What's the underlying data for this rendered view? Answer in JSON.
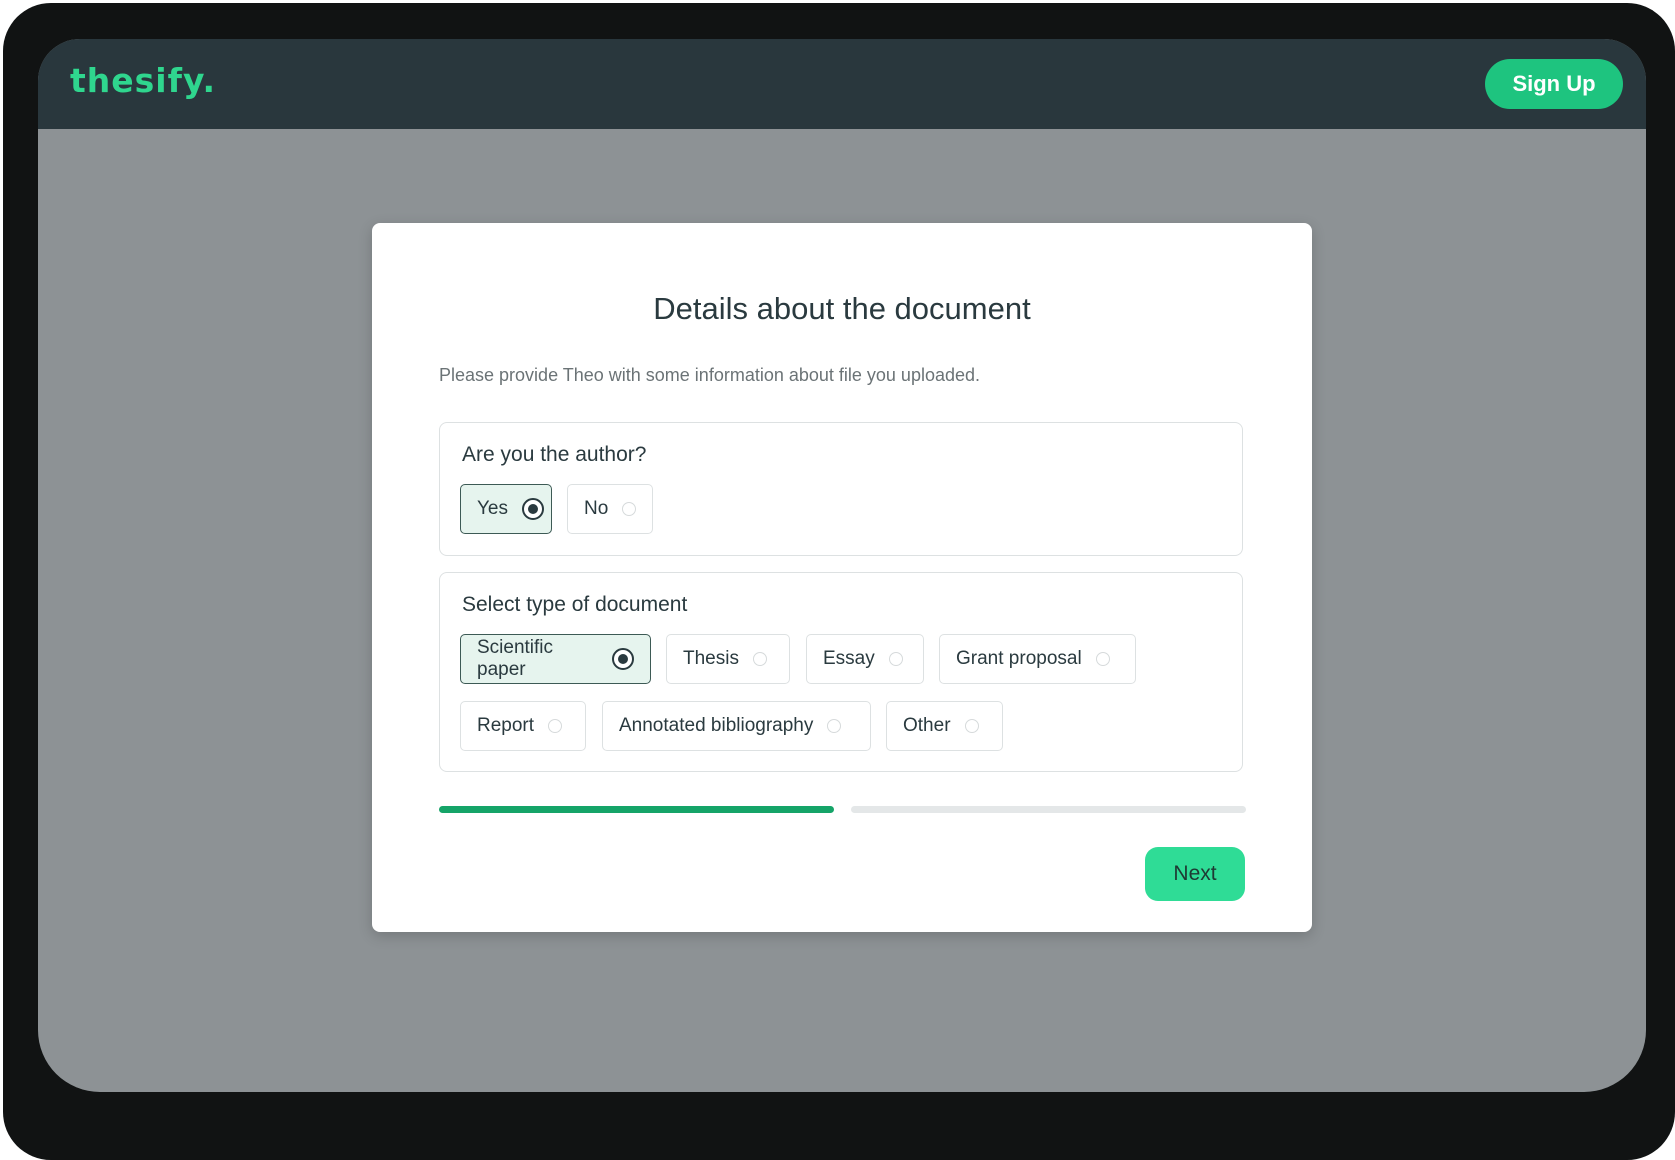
{
  "header": {
    "logo": "thesify.",
    "signup_label": "Sign Up"
  },
  "modal": {
    "title": "Details about the document",
    "subtitle": "Please provide Theo with some information about file you uploaded.",
    "author_question": {
      "label": "Are you the author?",
      "options": [
        {
          "label": "Yes",
          "selected": true
        },
        {
          "label": "No",
          "selected": false
        }
      ]
    },
    "doc_type": {
      "label": "Select type of document",
      "options": [
        {
          "label": "Scientific paper",
          "selected": true
        },
        {
          "label": "Thesis",
          "selected": false
        },
        {
          "label": "Essay",
          "selected": false
        },
        {
          "label": "Grant proposal",
          "selected": false
        },
        {
          "label": "Report",
          "selected": false
        },
        {
          "label": "Annotated bibliography",
          "selected": false
        },
        {
          "label": "Other",
          "selected": false
        }
      ]
    },
    "progress": {
      "current_step": 1,
      "total_steps": 2
    },
    "next_label": "Next"
  },
  "colors": {
    "topbar": "#29373d",
    "brand_green": "#2fd68e",
    "signup_button": "#1ec47f",
    "progress_done": "#15a468",
    "next_button": "#2fdc96",
    "overlay": "#8d9295"
  }
}
